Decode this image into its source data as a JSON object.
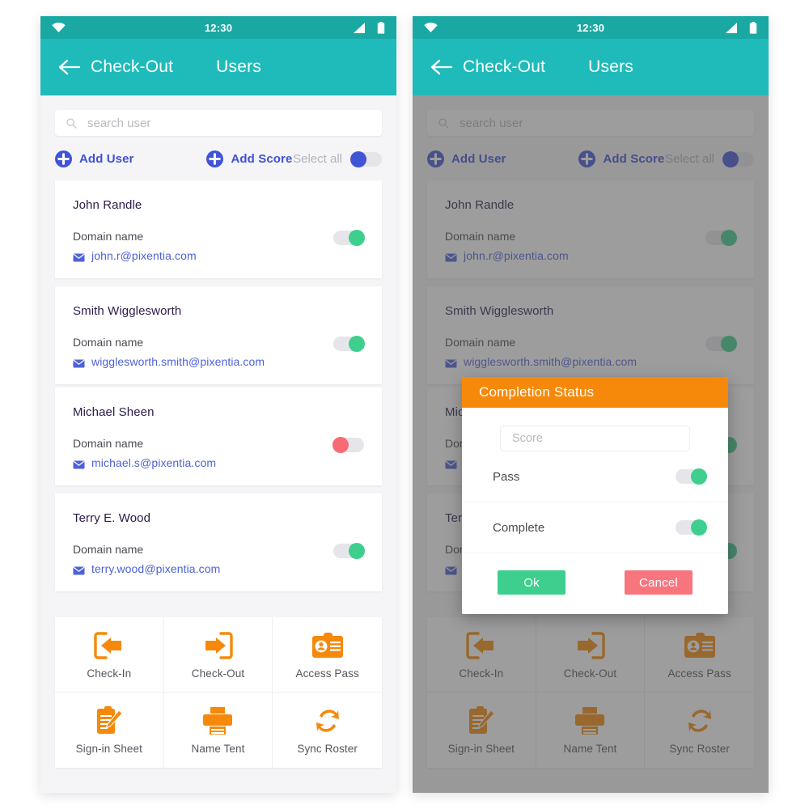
{
  "statusbar": {
    "time": "12:30",
    "icons": [
      "wifi-icon",
      "signal-icon",
      "battery-icon"
    ]
  },
  "appbar": {
    "back_icon": "back-arrow-icon",
    "title": "Check-Out",
    "subtitle": "Users",
    "background": "#1fbbba"
  },
  "search": {
    "icon": "search-icon",
    "placeholder": "search user"
  },
  "actions": {
    "add_user": {
      "label": "Add User",
      "icon": "plus-circle-icon"
    },
    "add_score": {
      "label": "Add Score",
      "icon": "plus-circle-icon"
    },
    "select_all": {
      "label": "Select all",
      "state": "off",
      "knob_color": "#4054d6"
    }
  },
  "users": [
    {
      "name": "John Randle",
      "domain_label": "Domain name",
      "email": "john.r@pixentia.com",
      "toggle": {
        "state": "on",
        "color": "#3ecf8e"
      }
    },
    {
      "name": "Smith Wigglesworth",
      "domain_label": "Domain name",
      "email": "wigglesworth.smith@pixentia.com",
      "toggle": {
        "state": "on",
        "color": "#3ecf8e"
      }
    },
    {
      "name": "Michael Sheen",
      "domain_label": "Domain name",
      "email": "michael.s@pixentia.com",
      "toggle": {
        "state": "off",
        "color": "#f86b75"
      }
    },
    {
      "name": "Terry E. Wood",
      "domain_label": "Domain name",
      "email": "terry.wood@pixentia.com",
      "toggle": {
        "state": "on",
        "color": "#3ecf8e"
      }
    }
  ],
  "tiles": [
    {
      "label": "Check-In",
      "icon": "check-in-icon"
    },
    {
      "label": "Check-Out",
      "icon": "check-out-icon"
    },
    {
      "label": "Access Pass",
      "icon": "access-pass-icon"
    },
    {
      "label": "Sign-in Sheet",
      "icon": "sign-in-sheet-icon"
    },
    {
      "label": "Name Tent",
      "icon": "name-tent-icon"
    },
    {
      "label": "Sync Roster",
      "icon": "sync-roster-icon"
    }
  ],
  "modal": {
    "title": "Completion Status",
    "header_color": "#f6890a",
    "score_placeholder": "Score",
    "score_value": "",
    "rows": [
      {
        "label": "Pass",
        "state": "on",
        "color": "#3ecf8e"
      },
      {
        "label": "Complete",
        "state": "on",
        "color": "#3ecf8e"
      }
    ],
    "ok_label": "Ok",
    "cancel_label": "Cancel",
    "ok_color": "#3ecf8e",
    "cancel_color": "#f8757e"
  },
  "theme": {
    "teal": "#1fbbba",
    "status_teal": "#1aa8a3",
    "indigo": "#4054d6",
    "orange": "#f6890a",
    "page_bg": "#f5f5f7"
  }
}
